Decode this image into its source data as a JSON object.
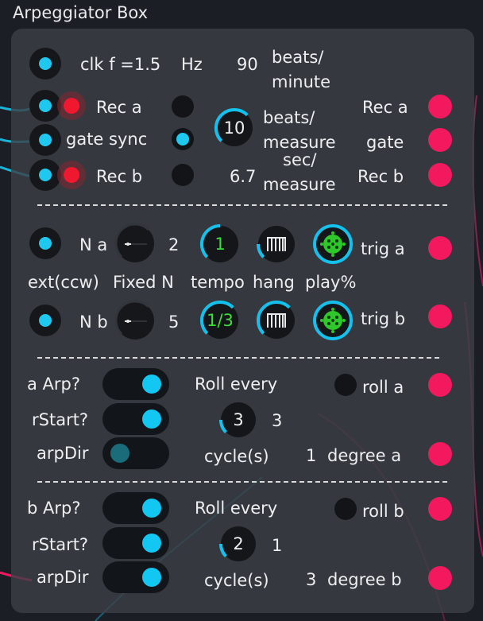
{
  "app": {
    "title": "Arpeggiator Box"
  },
  "clock": {
    "label": "clk f =1.5",
    "unit": "Hz",
    "bpm_value": "90",
    "bpm_unit_1": "beats/",
    "bpm_unit_2": "minute"
  },
  "record": {
    "rec_a": "Rec  a",
    "gate_sync": "gate  sync",
    "rec_b": "Rec  b",
    "beats_per_measure": "10",
    "bpm_label_1": "beats/",
    "bpm_label_2": "measure",
    "sec_value": "6.7",
    "sec_label_1": "sec/",
    "sec_label_2": "measure",
    "out_rec_a": "Rec a",
    "out_gate": "gate",
    "out_rec_b": "Rec b"
  },
  "voices": {
    "a": {
      "n_label": "N a",
      "n_value": "2",
      "tempo": "1",
      "trig": "trig a"
    },
    "b": {
      "n_label": "N b",
      "n_value": "5",
      "tempo": "1/3",
      "trig": "trig b"
    },
    "header": {
      "ext": "ext(ccw)",
      "fixed": "Fixed N",
      "tempo": "tempo",
      "hang": "hang",
      "play": "play%"
    }
  },
  "section_a": {
    "arp_label": "a   Arp?",
    "rstart_label": "rStart?",
    "arpdir_label": "arpDir",
    "arp_on": true,
    "rstart_on": true,
    "arpdir_on": false,
    "roll_every": "Roll every",
    "cycle_value": "3",
    "cycle_extra": "3",
    "cycles_label": "cycle(s)",
    "degree_value": "1",
    "degree_label": "degree a",
    "roll_label": "roll a"
  },
  "section_b": {
    "arp_label": "b   Arp?",
    "rstart_label": "rStart?",
    "arpdir_label": "arpDir",
    "arp_on": true,
    "rstart_on": true,
    "arpdir_on": true,
    "roll_every": "Roll every",
    "cycle_value": "2",
    "cycle_extra": "1",
    "cycles_label": "cycle(s)",
    "degree_value": "3",
    "degree_label": "degree b",
    "roll_label": "roll b"
  },
  "colors": {
    "accent": "#1ec8ee",
    "record": "#f0182e",
    "output": "#f2195f",
    "tempo_text": "#39e03a"
  }
}
